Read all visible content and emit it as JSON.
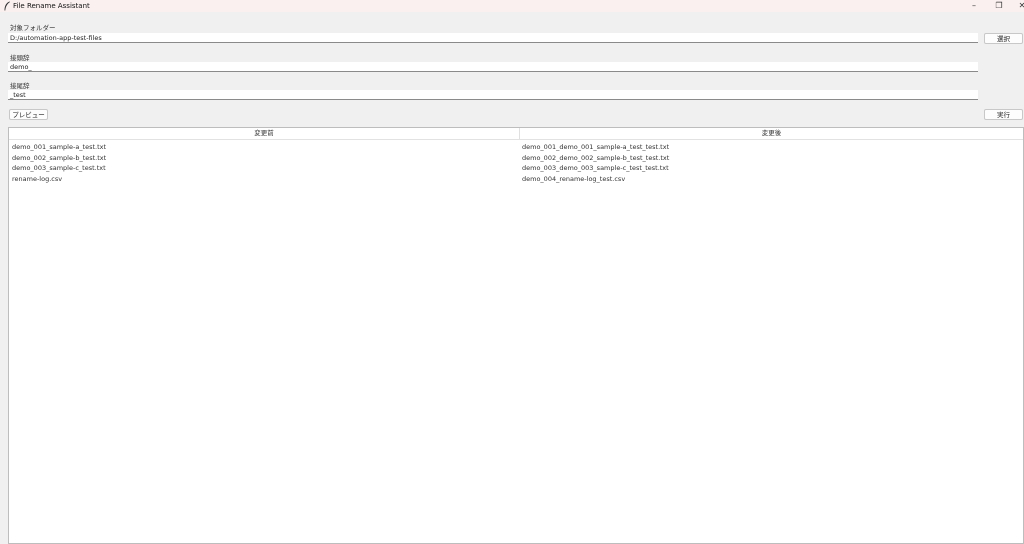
{
  "window": {
    "title": "File Rename Assistant",
    "controls": {
      "minimize": "–",
      "maximize": "❐",
      "close": "✕"
    }
  },
  "form": {
    "folder_label": "対象フォルダー",
    "folder_value": "D:/automation-app-test-files",
    "select_button": "選択",
    "prefix_label": "接頭辞",
    "prefix_value": "demo_",
    "suffix_label": "接尾辞",
    "suffix_value": "_test",
    "preview_button": "プレビュー",
    "execute_button": "実行"
  },
  "table": {
    "columns": [
      "変更前",
      "変更後"
    ],
    "rows": [
      [
        "demo_001_sample-a_test.txt",
        "demo_001_demo_001_sample-a_test_test.txt"
      ],
      [
        "demo_002_sample-b_test.txt",
        "demo_002_demo_002_sample-b_test_test.txt"
      ],
      [
        "demo_003_sample-c_test.txt",
        "demo_003_demo_003_sample-c_test_test.txt"
      ],
      [
        "rename-log.csv",
        "demo_004_rename-log_test.csv"
      ]
    ]
  },
  "colors": {
    "titlebar": "#fbf0f0",
    "background": "#f0f0f0",
    "table_bg": "#ffffff"
  }
}
